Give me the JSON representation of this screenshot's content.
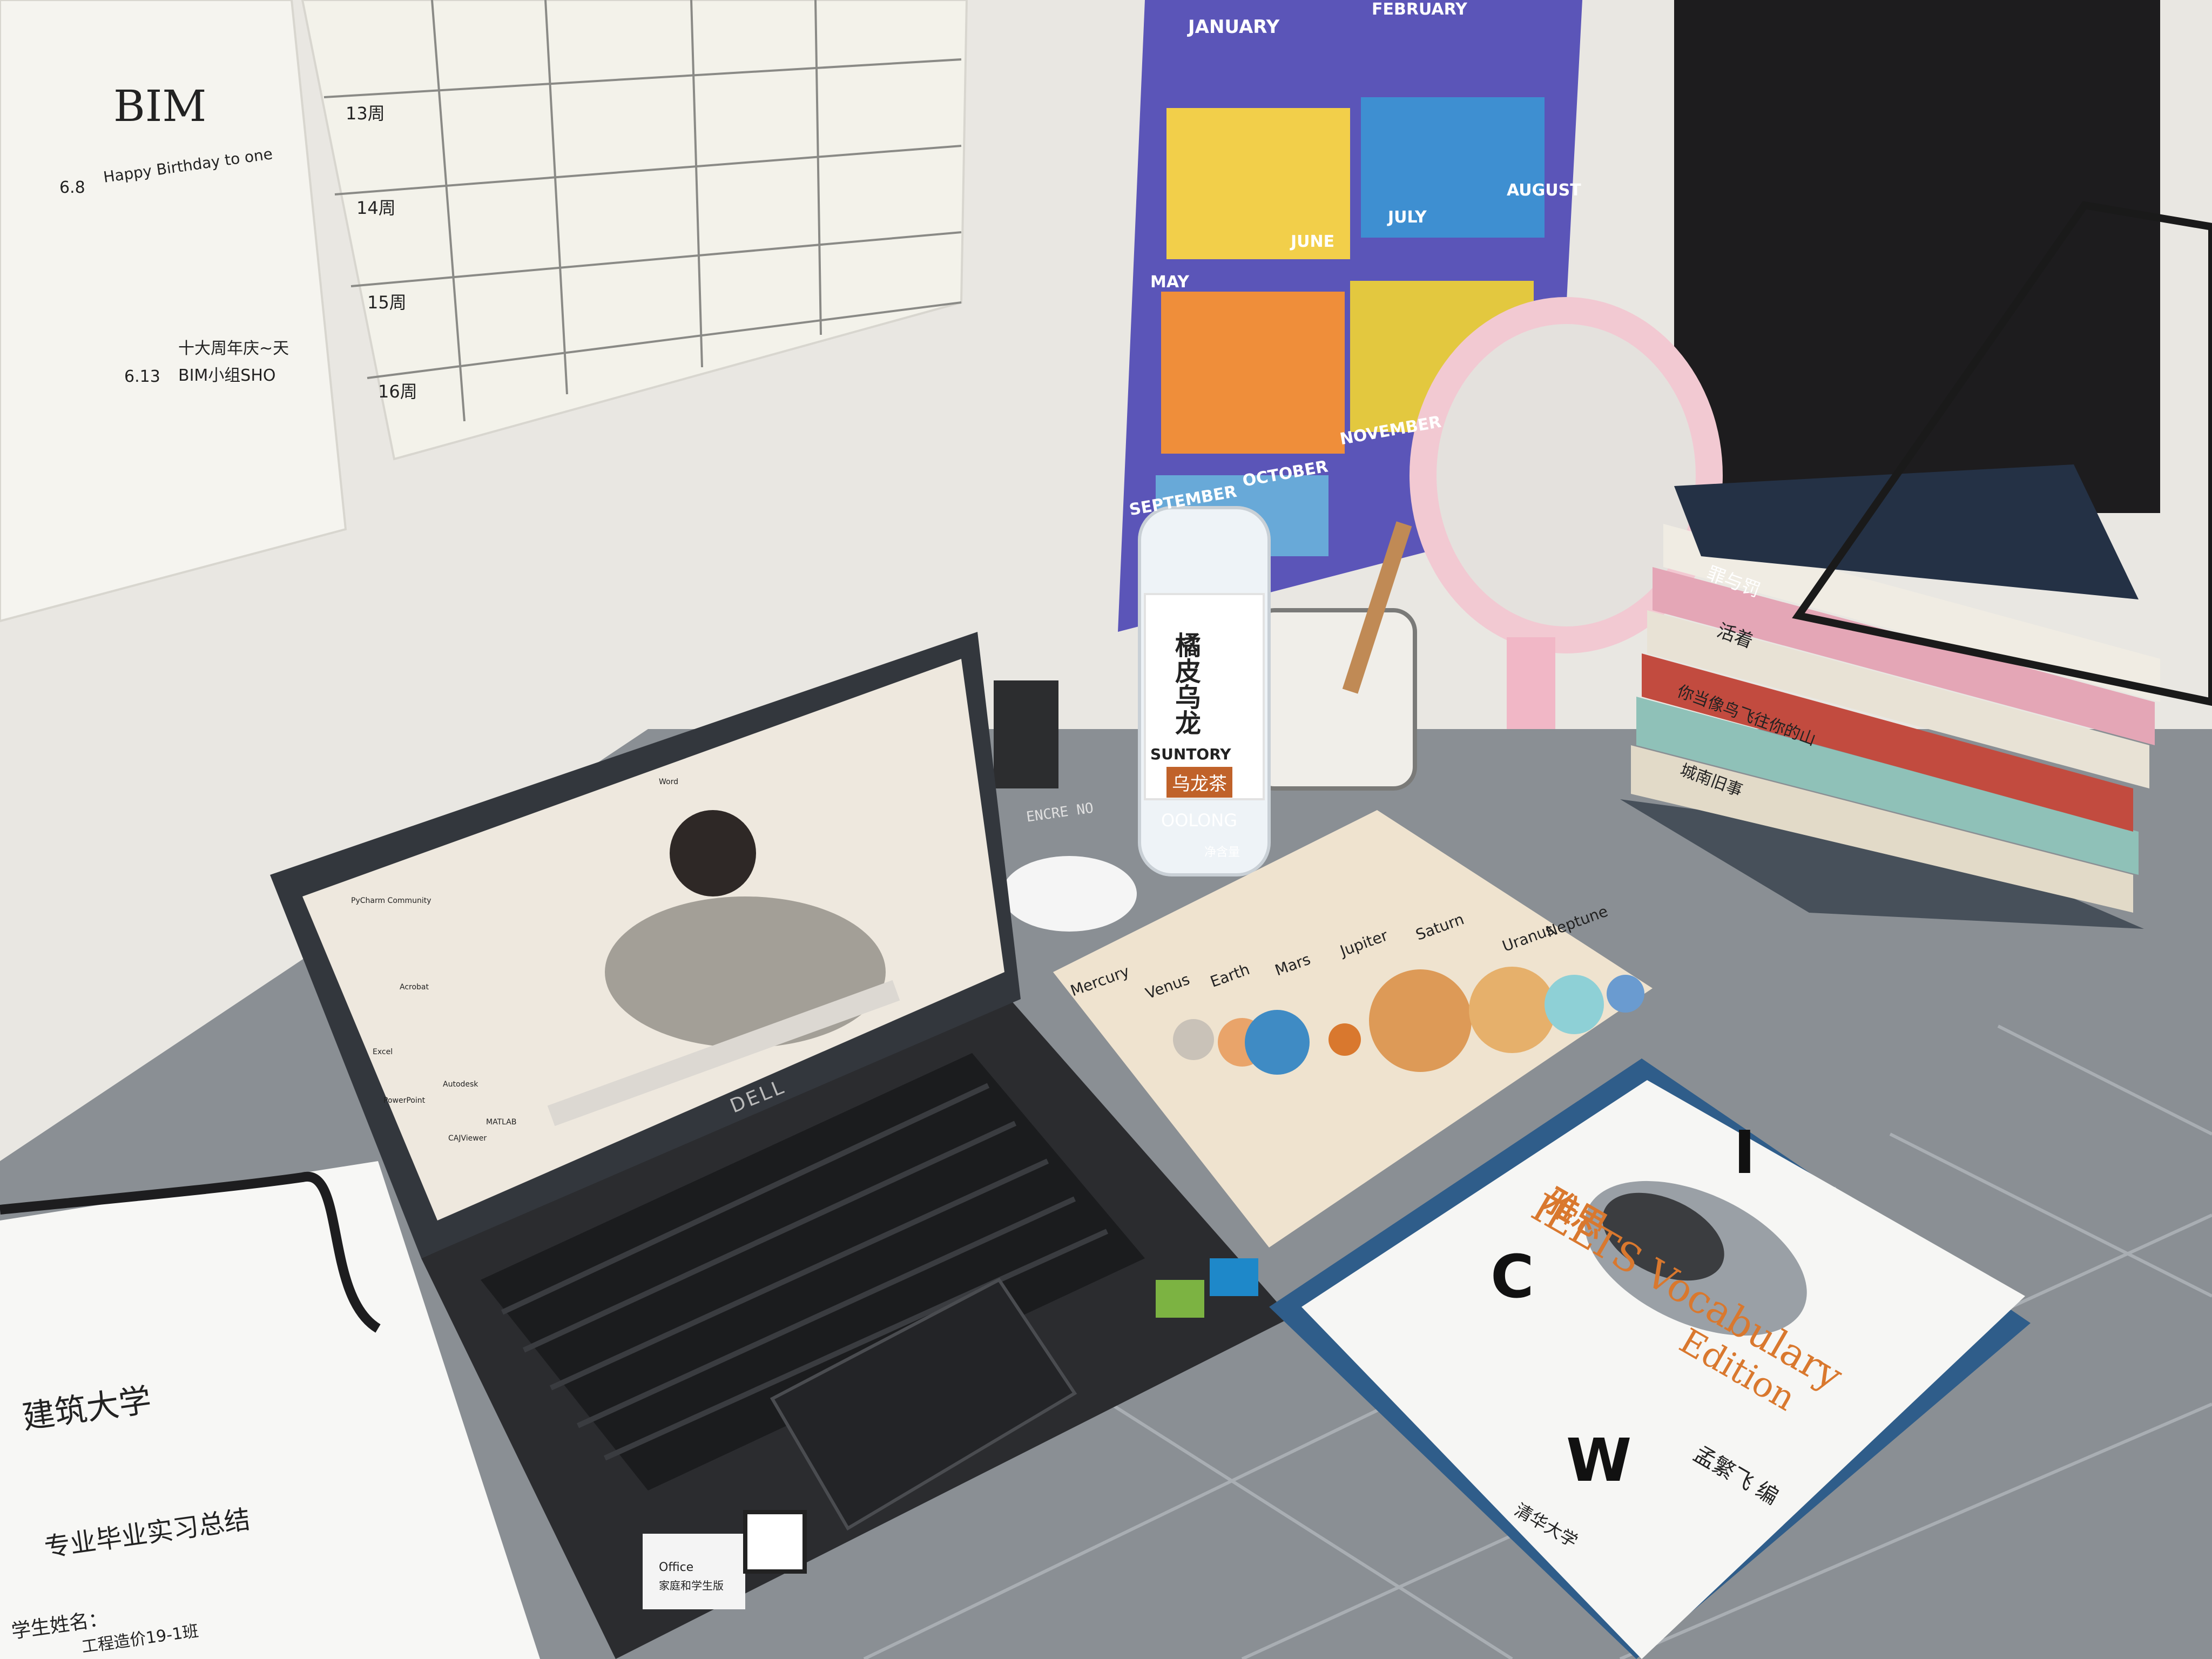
{
  "wall_notes": {
    "left_note": {
      "lines": [
        "BIM",
        "Happy Birthday to one",
        "6.8",
        "6.13",
        "十大周年庆~天",
        "BIM小组SHO"
      ]
    },
    "schedule_note": {
      "rows": [
        "13周",
        "14周",
        "15周",
        "16周"
      ]
    }
  },
  "calendar": {
    "months": [
      "JANUARY",
      "FEBRUARY",
      "JUNE",
      "JULY",
      "AUGUST",
      "MAY",
      "SEPTEMBER",
      "OCTOBER",
      "NOVEMBER"
    ]
  },
  "water_bottle": {
    "name": "橘皮乌龙",
    "brand": "SUNTORY",
    "sub_label": "乌龙茶",
    "flavor": "OOLONG",
    "volume": "净含量"
  },
  "laptop": {
    "brand": "DELL",
    "desktop_icons": [
      "PyCharm Community",
      "Acrobat",
      "Word",
      "Excel",
      "PowerPoint",
      "CAJViewer",
      "Autodesk",
      "MATLAB"
    ],
    "sticker_text": [
      "Office",
      "家庭和学生版"
    ]
  },
  "earbuds_case_text": "ENCRE NO",
  "ipad_case": {
    "planets": [
      "Mercury",
      "Venus",
      "Earth",
      "Mars",
      "Jupiter",
      "Saturn",
      "Uranus",
      "Neptune"
    ]
  },
  "vocab_book": {
    "title_cn": "雅思",
    "title_en": "IELTS Vocabulary",
    "subtitle": "Edition",
    "letters": [
      "C",
      "I",
      "W"
    ],
    "author": "孟繁飞 编",
    "publisher": "清华大学"
  },
  "report_paper": {
    "school": "建筑大学",
    "title": "专业毕业实习总结",
    "line1": "学生姓名：",
    "line2": "工程造价19-1班"
  },
  "book_stack": {
    "spines": [
      "罪与罚",
      "活着",
      "你当像鸟飞往你的山",
      "城南旧事"
    ]
  },
  "colors": {
    "wall": "#e9e7e2",
    "desk_grey": "#7f858b",
    "laptop_body": "#2b2c2f",
    "accent_orange": "#d9782e"
  }
}
